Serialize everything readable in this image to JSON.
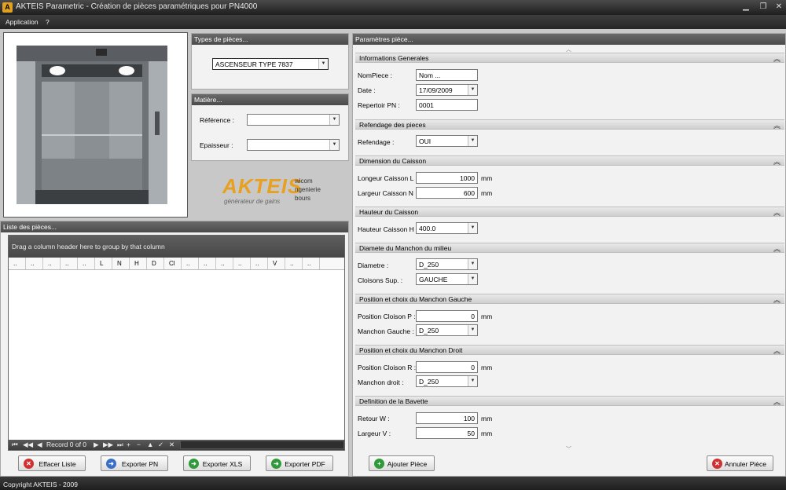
{
  "window": {
    "title": "AKTEIS Parametric - Création de pièces paramétriques pour PN4000",
    "icon": "app-logo-icon"
  },
  "menu": {
    "items": [
      "Application",
      "?"
    ]
  },
  "types_panel": {
    "header": "Types de pièces...",
    "selected": "ASCENSEUR TYPE 7837"
  },
  "matiere_panel": {
    "header": "Matière...",
    "reference_label": "Référence :",
    "reference_value": "",
    "epaisseur_label": "Epaisseur :",
    "epaisseur_value": ""
  },
  "logo": {
    "brand": "AKTEIS",
    "tagline": "générateur de gains",
    "side_words": [
      "wicom",
      "ngenierie",
      "bours"
    ]
  },
  "liste_panel": {
    "header": "Liste des pièces...",
    "group_hint": "Drag a column header here to group by that column",
    "columns": [
      "..",
      "..",
      "..",
      "..",
      "..",
      "L",
      "N",
      "H",
      "D",
      "Cl",
      "..",
      "..",
      "..",
      "..",
      "..",
      "V",
      "..",
      ".."
    ],
    "record_text": "Record 0 of 0"
  },
  "bottom_buttons": {
    "effacer": "Effacer Liste",
    "exporter_pn": "Exporter PN",
    "exporter_xls": "Exporter XLS",
    "exporter_pdf": "Exporter PDF",
    "ajouter": "Ajouter Pièce",
    "annuler": "Annuler Pièce"
  },
  "params_panel": {
    "header": "Paramètres pièce...",
    "sections": {
      "infos": {
        "title": "Informations Generales",
        "nom_label": "NomPiece :",
        "nom_value": "Nom ...",
        "date_label": "Date :",
        "date_value": "17/09/2009",
        "rep_label": "Repertoir PN :",
        "rep_value": "0001"
      },
      "refendage": {
        "title": "Refendage des pieces",
        "label": "Refendage :",
        "value": "OUI"
      },
      "dimension": {
        "title": "Dimension du Caisson",
        "longueur_label": "Longeur Caisson L :",
        "longueur_value": "1000",
        "largeur_label": "Largeur Caisson N :",
        "largeur_value": "600",
        "unit": "mm"
      },
      "hauteur": {
        "title": "Hauteur du Caisson",
        "label": "Hauteur Caisson H :",
        "value": "400.0"
      },
      "diametre": {
        "title": "Diamete du Manchon du milieu",
        "diam_label": "Diametre :",
        "diam_value": "D_250",
        "cloisons_label": "Cloisons Sup. :",
        "cloisons_value": "GAUCHE"
      },
      "gauche": {
        "title": "Position et choix du Manchon Gauche",
        "pos_label": "Position Cloison P :",
        "pos_value": "0",
        "manchon_label": "Manchon Gauche :",
        "manchon_value": "D_250",
        "unit": "mm"
      },
      "droit": {
        "title": "Position et choix du Manchon Droit",
        "pos_label": "Position Cloison R :",
        "pos_value": "0",
        "manchon_label": "Manchon droit :",
        "manchon_value": "D_250",
        "unit": "mm"
      },
      "bavette": {
        "title": "Definition de la Bavette",
        "retour_label": "Retour  W :",
        "retour_value": "100",
        "largeur_label": "Largeur V :",
        "largeur_value": "50",
        "unit": "mm"
      }
    }
  },
  "status": {
    "text": "Copyright AKTEIS - 2009"
  },
  "colors": {
    "header_dark": "#4b4b4b",
    "accent_orange": "#e8a020",
    "panel_bg": "#f2f2f2"
  }
}
